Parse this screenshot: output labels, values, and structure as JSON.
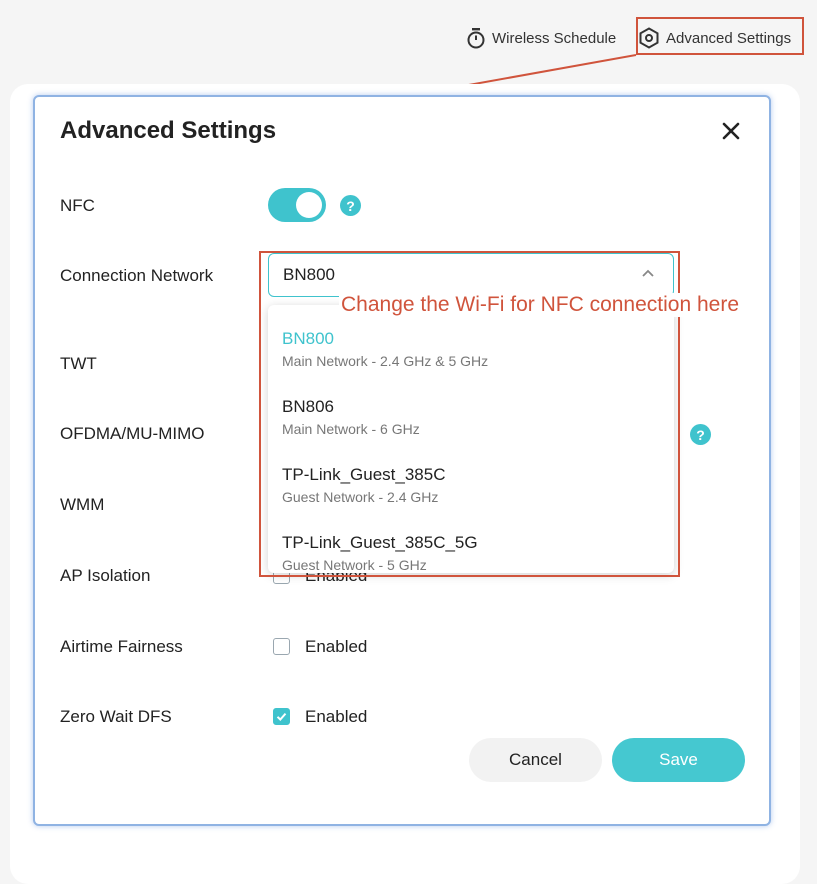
{
  "top_bar": {
    "wireless_schedule": "Wireless Schedule",
    "advanced_settings": "Advanced Settings"
  },
  "modal": {
    "title": "Advanced Settings",
    "rows": {
      "nfc": "NFC",
      "connection_network": "Connection Network",
      "twt": "TWT",
      "ofdma": "OFDMA/MU-MIMO",
      "wmm": "WMM",
      "ap_isolation": "AP Isolation",
      "airtime_fairness": "Airtime Fairness",
      "zero_wait_dfs": "Zero Wait DFS"
    },
    "nfc_toggle_on": true,
    "connection_select": {
      "value": "BN800",
      "options": [
        {
          "name": "BN800",
          "sub": "Main Network - 2.4 GHz & 5 GHz",
          "selected": true
        },
        {
          "name": "BN806",
          "sub": "Main Network - 6 GHz"
        },
        {
          "name": "TP-Link_Guest_385C",
          "sub": "Guest Network - 2.4 GHz"
        },
        {
          "name": "TP-Link_Guest_385C_5G",
          "sub": "Guest Network - 5 GHz"
        }
      ]
    },
    "checkbox_label": "Enabled",
    "ap_isolation_partial_label": "Enabled",
    "airtime_fairness_checked": false,
    "zero_wait_dfs_checked": true,
    "cancel": "Cancel",
    "save": "Save"
  },
  "annotation": {
    "text": "Change the Wi-Fi for NFC connection here",
    "color": "#d0543c"
  },
  "colors": {
    "accent": "#3fc3cd",
    "annotation": "#d0543c"
  },
  "icons": {
    "schedule": "stopwatch-icon",
    "settings": "hexagon-gear-icon",
    "help": "question-circle-icon",
    "close": "close-icon",
    "chevron": "chevron-up-icon"
  }
}
